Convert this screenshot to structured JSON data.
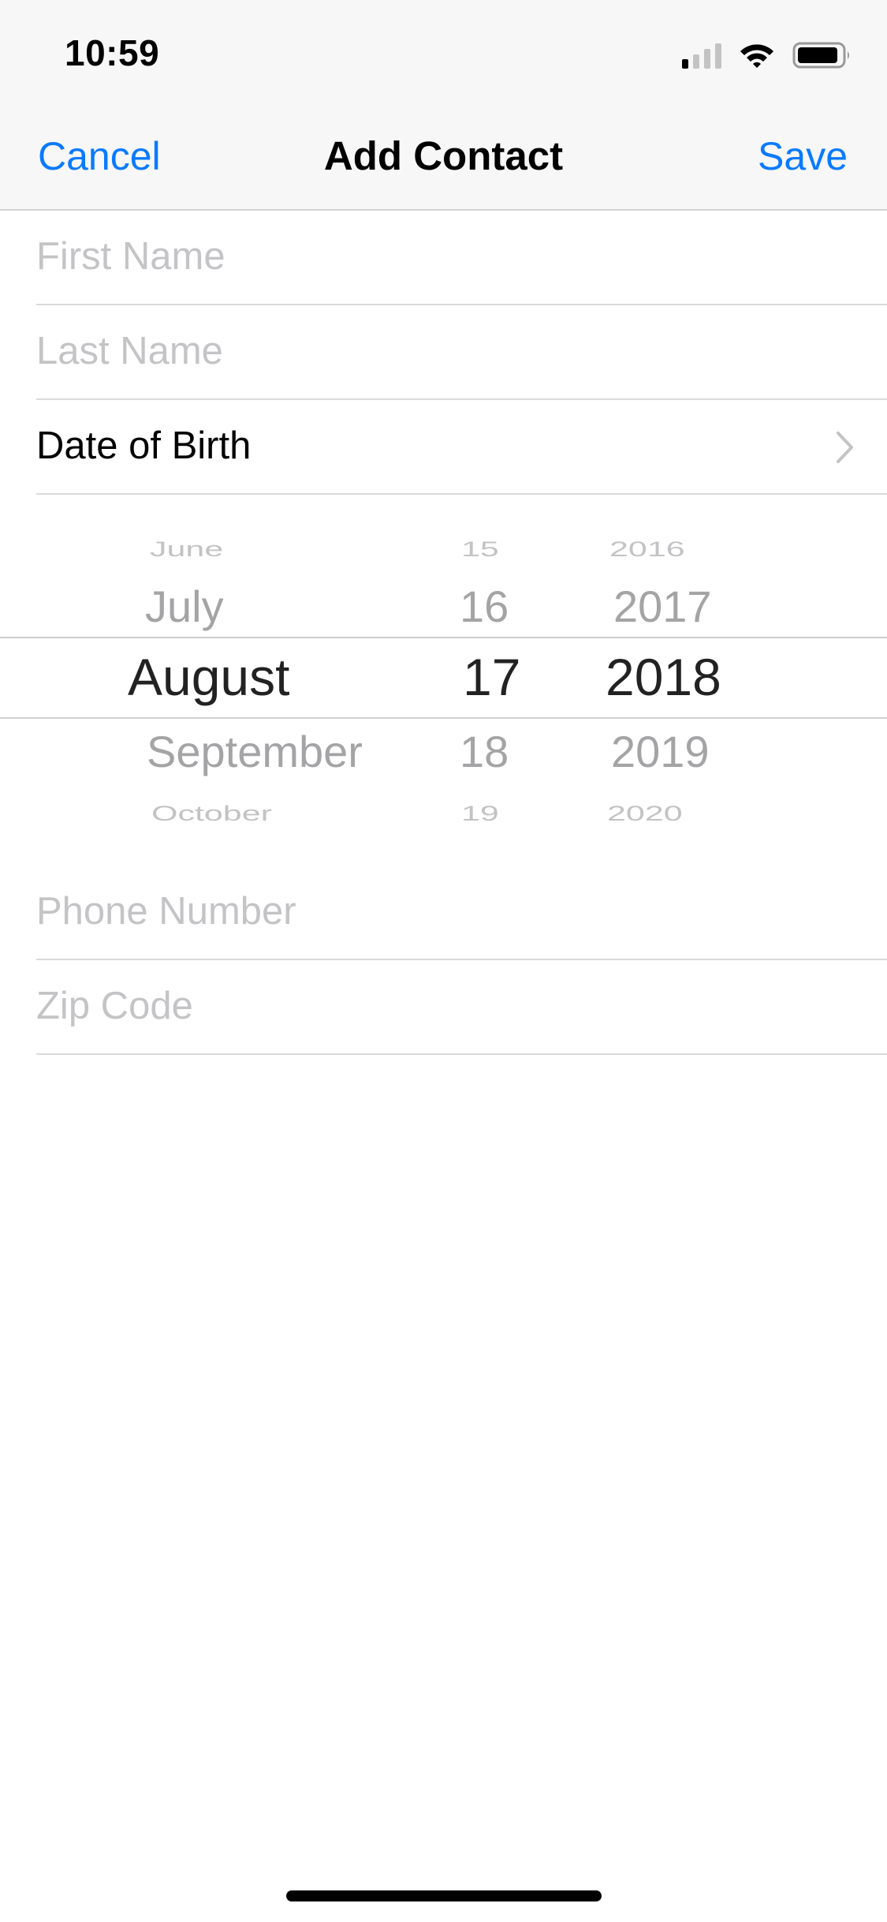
{
  "status_bar": {
    "time": "10:59",
    "signal_icon": "cellular-signal-icon",
    "wifi_icon": "wifi-icon",
    "battery_icon": "battery-icon"
  },
  "nav_bar": {
    "cancel_label": "Cancel",
    "title": "Add Contact",
    "save_label": "Save",
    "accent_color": "#0a7aff"
  },
  "form": {
    "first_name_placeholder": "First Name",
    "last_name_placeholder": "Last Name",
    "date_of_birth_label": "Date of Birth",
    "phone_placeholder": "Phone Number",
    "zip_placeholder": "Zip Code"
  },
  "date_picker": {
    "months": [
      "June",
      "July",
      "August",
      "September",
      "October"
    ],
    "days": [
      "15",
      "16",
      "17",
      "18",
      "19"
    ],
    "years": [
      "2016",
      "2017",
      "2018",
      "2019",
      "2020"
    ],
    "selected": {
      "month": "August",
      "day": "17",
      "year": "2018"
    }
  }
}
